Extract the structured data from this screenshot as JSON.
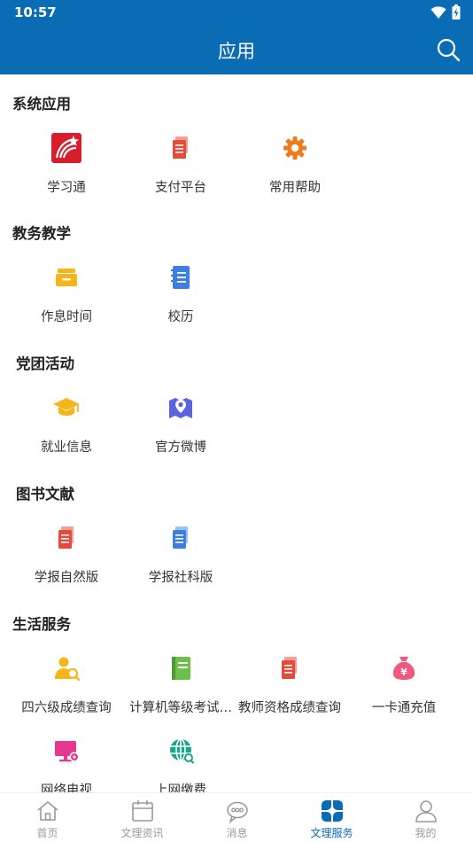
{
  "status_bar": {
    "time": "10:57",
    "wifi_icon": "wifi-icon",
    "battery_icon": "battery-charging-icon"
  },
  "header": {
    "title": "应用",
    "search_icon": "search-icon"
  },
  "sections": [
    {
      "title": "系统应用",
      "items": [
        {
          "label": "学习通",
          "icon": "xuexitong-logo-icon",
          "color": "#d81e2b"
        },
        {
          "label": "支付平台",
          "icon": "document-icon",
          "color": "#e84a3a"
        },
        {
          "label": "常用帮助",
          "icon": "gear-icon",
          "color": "#f07b1d"
        }
      ]
    },
    {
      "title": "教务教学",
      "items": [
        {
          "label": "作息时间",
          "icon": "tray-icon",
          "color": "#f6b518"
        },
        {
          "label": "校历",
          "icon": "notebook-icon",
          "color": "#3c7fe0"
        }
      ]
    },
    {
      "title": "党团活动",
      "items": [
        {
          "label": "就业信息",
          "icon": "graduation-cap-icon",
          "color": "#f6b518"
        },
        {
          "label": "官方微博",
          "icon": "map-pin-icon",
          "color": "#5a63e0"
        }
      ]
    },
    {
      "title": "图书文献",
      "items": [
        {
          "label": "学报自然版",
          "icon": "document-icon",
          "color": "#e84a3a"
        },
        {
          "label": "学报社科版",
          "icon": "document-icon",
          "color": "#3c7fe0"
        }
      ]
    },
    {
      "title": "生活服务",
      "items": [
        {
          "label": "四六级成绩查询",
          "icon": "user-search-icon",
          "color": "#f6b518"
        },
        {
          "label": "计算机等级考试…",
          "icon": "book-icon",
          "color": "#6cc04a"
        },
        {
          "label": "教师资格成绩查询",
          "icon": "document-icon",
          "color": "#e84a3a"
        },
        {
          "label": "一卡通充值",
          "icon": "money-bag-icon",
          "color": "#f2577d"
        },
        {
          "label": "网络电视",
          "icon": "monitor-gear-icon",
          "color": "#e5398f"
        },
        {
          "label": "上网缴费",
          "icon": "globe-icon",
          "color": "#1aa58a"
        }
      ]
    }
  ],
  "tabs": [
    {
      "label": "首页",
      "icon": "home-icon",
      "active": false
    },
    {
      "label": "文理资讯",
      "icon": "calendar-icon",
      "active": false
    },
    {
      "label": "消息",
      "icon": "chat-bubble-icon",
      "active": false
    },
    {
      "label": "文理服务",
      "icon": "grid-petals-icon",
      "active": true
    },
    {
      "label": "我的",
      "icon": "person-icon",
      "active": false
    }
  ],
  "colors": {
    "primary": "#0a6cb4",
    "tab_inactive": "#9a9a9a"
  }
}
